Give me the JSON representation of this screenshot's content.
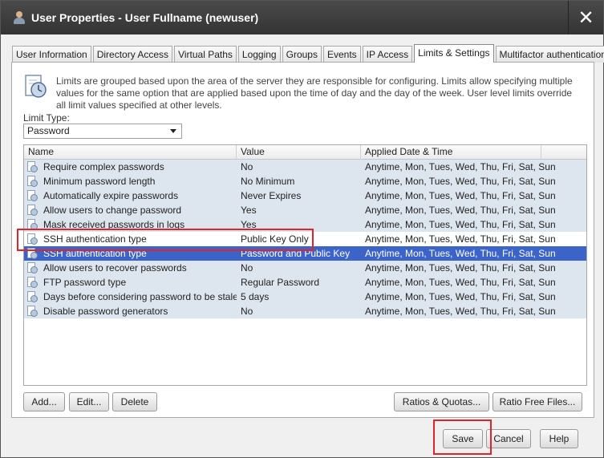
{
  "window": {
    "title": "User Properties - User Fullname (newuser)",
    "close_label": "✕"
  },
  "tabs": [
    {
      "label": "User Information"
    },
    {
      "label": "Directory Access"
    },
    {
      "label": "Virtual Paths"
    },
    {
      "label": "Logging"
    },
    {
      "label": "Groups"
    },
    {
      "label": "Events"
    },
    {
      "label": "IP Access"
    },
    {
      "label": "Limits & Settings",
      "active": true
    },
    {
      "label": "Multifactor authentication"
    }
  ],
  "info_text": "Limits are grouped based upon the area of the server they are responsible for configuring. Limits allow specifying multiple values for the same option that are applied based upon the time of day and the day of the week. User level limits override all limit values specified at other levels.",
  "limit_type": {
    "label": "Limit Type:",
    "selected": "Password"
  },
  "grid": {
    "columns": [
      "Name",
      "Value",
      "Applied Date & Time",
      ""
    ],
    "rows": [
      {
        "name": "Require complex passwords",
        "value": "No",
        "date": "Anytime, Mon, Tues, Wed, Thu, Fri, Sat, Sun"
      },
      {
        "name": "Minimum password length",
        "value": "No Minimum",
        "date": "Anytime, Mon, Tues, Wed, Thu, Fri, Sat, Sun"
      },
      {
        "name": "Automatically expire passwords",
        "value": "Never Expires",
        "date": "Anytime, Mon, Tues, Wed, Thu, Fri, Sat, Sun"
      },
      {
        "name": "Allow users to change password",
        "value": "Yes",
        "date": "Anytime, Mon, Tues, Wed, Thu, Fri, Sat, Sun"
      },
      {
        "name": "Mask received passwords in logs",
        "value": "Yes",
        "date": "Anytime, Mon, Tues, Wed, Thu, Fri, Sat, Sun"
      },
      {
        "name": "SSH authentication type",
        "value": "Public Key Only",
        "date": "Anytime, Mon, Tues, Wed, Thu, Fri, Sat, Sun",
        "white": true
      },
      {
        "name": "SSH authentication type",
        "value": "Password and Public Key",
        "date": "Anytime, Mon, Tues, Wed, Thu, Fri, Sat, Sun",
        "selected": true
      },
      {
        "name": "Allow users to recover passwords",
        "value": "No",
        "date": "Anytime, Mon, Tues, Wed, Thu, Fri, Sat, Sun"
      },
      {
        "name": "FTP password type",
        "value": "Regular Password",
        "date": "Anytime, Mon, Tues, Wed, Thu, Fri, Sat, Sun"
      },
      {
        "name": "Days before considering password to be stale",
        "value": "5 days",
        "date": "Anytime, Mon, Tues, Wed, Thu, Fri, Sat, Sun"
      },
      {
        "name": "Disable password generators",
        "value": "No",
        "date": "Anytime, Mon, Tues, Wed, Thu, Fri, Sat, Sun"
      }
    ]
  },
  "panel_buttons": {
    "add": "Add...",
    "edit": "Edit...",
    "delete": "Delete",
    "ratios": "Ratios & Quotas...",
    "ratio_free": "Ratio Free Files..."
  },
  "dialog_buttons": {
    "save": "Save",
    "cancel": "Cancel",
    "help": "Help"
  },
  "colors": {
    "selection": "#3c64c8",
    "row_alt": "#dde6ef",
    "highlight": "#e0242b",
    "titlebar": "#3a3a3a"
  }
}
